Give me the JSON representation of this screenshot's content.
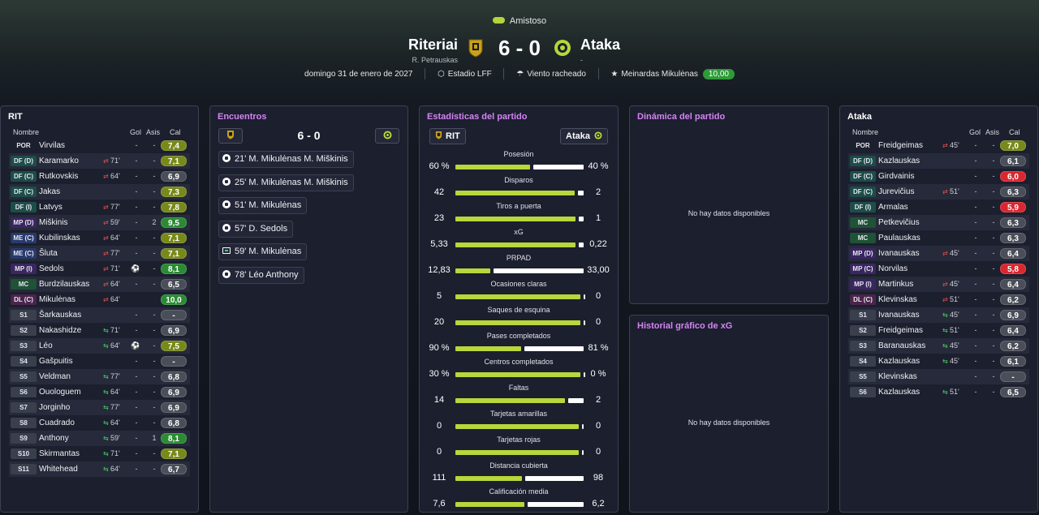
{
  "header": {
    "competition": "Amistoso",
    "home_name": "Riteriai",
    "home_manager": "R. Petrauskas",
    "away_name": "Ataka",
    "away_manager": "-",
    "score": "6 - 0",
    "date": "domingo 31 de enero de 2027",
    "stadium": "Estadio LFF",
    "weather": "Viento racheado",
    "motm_name": "Meinardas Mikulėnas",
    "motm_rating": "10,00"
  },
  "colors": {
    "accent": "#b9d63b",
    "pink_title": "#d683f4",
    "good": "#2b8a34",
    "bad": "#d92730"
  },
  "home_panel": {
    "title": "RIT",
    "col_name": "Nombre",
    "col_goals": "Gol",
    "col_assists": "Asis",
    "col_rating": "Cal",
    "players": [
      {
        "pos": "POR",
        "cls": "gk",
        "name": "Virvilas",
        "sub": "",
        "min": "",
        "goals": "-",
        "assists": "-",
        "rating": "7,4",
        "rc": "r-olive"
      },
      {
        "pos": "DF (D)",
        "cls": "df",
        "name": "Karamarko",
        "sub": "out",
        "min": "71'",
        "goals": "-",
        "assists": "-",
        "rating": "7,1",
        "rc": "r-olive"
      },
      {
        "pos": "DF (C)",
        "cls": "df",
        "name": "Rutkovskis",
        "sub": "out",
        "min": "64'",
        "goals": "-",
        "assists": "-",
        "rating": "6,9",
        "rc": "r-grey"
      },
      {
        "pos": "DF (C)",
        "cls": "df",
        "name": "Jakas",
        "sub": "",
        "min": "",
        "goals": "-",
        "assists": "-",
        "rating": "7,3",
        "rc": "r-olive"
      },
      {
        "pos": "DF (I)",
        "cls": "df",
        "name": "Latvys",
        "sub": "out",
        "min": "77'",
        "goals": "-",
        "assists": "-",
        "rating": "7,8",
        "rc": "r-olive"
      },
      {
        "pos": "MP (D)",
        "cls": "mf",
        "name": "Miškinis",
        "sub": "out",
        "min": "59'",
        "goals": "-",
        "assists": "2",
        "rating": "9,5",
        "rc": "r-green"
      },
      {
        "pos": "ME (C)",
        "cls": "me",
        "name": "Kubilinskas",
        "sub": "out",
        "min": "64'",
        "goals": "-",
        "assists": "-",
        "rating": "7,1",
        "rc": "r-olive"
      },
      {
        "pos": "ME (C)",
        "cls": "me",
        "name": "Šluta",
        "sub": "out",
        "min": "77'",
        "goals": "-",
        "assists": "-",
        "rating": "7,1",
        "rc": "r-olive"
      },
      {
        "pos": "MP (I)",
        "cls": "mf",
        "name": "Sedols",
        "sub": "out",
        "min": "71'",
        "goals": "ball",
        "assists": "-",
        "rating": "8,1",
        "rc": "r-green"
      },
      {
        "pos": "MC",
        "cls": "mc",
        "name": "Burdzilauskas",
        "sub": "out",
        "min": "64'",
        "goals": "-",
        "assists": "-",
        "rating": "6,5",
        "rc": "r-grey"
      },
      {
        "pos": "DL (C)",
        "cls": "dl",
        "name": "Mikulėnas",
        "sub": "out",
        "min": "64'",
        "goals": "",
        "assists": "",
        "rating": "10,0",
        "rc": "r-green"
      },
      {
        "pos": "S1",
        "cls": "sub",
        "name": "Šarkauskas",
        "sub": "",
        "min": "",
        "goals": "-",
        "assists": "-",
        "rating": "-",
        "rc": "r-grey"
      },
      {
        "pos": "S2",
        "cls": "sub",
        "name": "Nakashidze",
        "sub": "in",
        "min": "71'",
        "goals": "-",
        "assists": "-",
        "rating": "6,9",
        "rc": "r-grey"
      },
      {
        "pos": "S3",
        "cls": "sub",
        "name": "Léo",
        "sub": "in",
        "min": "64'",
        "goals": "ball",
        "assists": "-",
        "rating": "7,5",
        "rc": "r-olive"
      },
      {
        "pos": "S4",
        "cls": "sub",
        "name": "Gašpuitis",
        "sub": "",
        "min": "",
        "goals": "-",
        "assists": "-",
        "rating": "-",
        "rc": "r-grey"
      },
      {
        "pos": "S5",
        "cls": "sub",
        "name": "Veldman",
        "sub": "in",
        "min": "77'",
        "goals": "-",
        "assists": "-",
        "rating": "6,8",
        "rc": "r-grey"
      },
      {
        "pos": "S6",
        "cls": "sub",
        "name": "Ouologuem",
        "sub": "in",
        "min": "64'",
        "goals": "-",
        "assists": "-",
        "rating": "6,9",
        "rc": "r-grey"
      },
      {
        "pos": "S7",
        "cls": "sub",
        "name": "Jorginho",
        "sub": "in",
        "min": "77'",
        "goals": "-",
        "assists": "-",
        "rating": "6,9",
        "rc": "r-grey"
      },
      {
        "pos": "S8",
        "cls": "sub",
        "name": "Cuadrado",
        "sub": "in",
        "min": "64'",
        "goals": "-",
        "assists": "-",
        "rating": "6,8",
        "rc": "r-grey"
      },
      {
        "pos": "S9",
        "cls": "sub",
        "name": "Anthony",
        "sub": "in",
        "min": "59'",
        "goals": "-",
        "assists": "1",
        "rating": "8,1",
        "rc": "r-green"
      },
      {
        "pos": "S10",
        "cls": "sub",
        "name": "Skirmantas",
        "sub": "in",
        "min": "71'",
        "goals": "-",
        "assists": "-",
        "rating": "7,1",
        "rc": "r-olive"
      },
      {
        "pos": "S11",
        "cls": "sub",
        "name": "Whitehead",
        "sub": "in",
        "min": "64'",
        "goals": "-",
        "assists": "-",
        "rating": "6,7",
        "rc": "r-grey"
      }
    ]
  },
  "away_panel": {
    "title": "Ataka",
    "col_name": "Nombre",
    "col_goals": "Gol",
    "col_assists": "Asis",
    "col_rating": "Cal",
    "players": [
      {
        "pos": "POR",
        "cls": "gk",
        "name": "Freidgeimas",
        "sub": "out",
        "min": "45'",
        "goals": "-",
        "assists": "-",
        "rating": "7,0",
        "rc": "r-olive"
      },
      {
        "pos": "DF (D)",
        "cls": "df",
        "name": "Kazlauskas",
        "sub": "",
        "min": "",
        "goals": "-",
        "assists": "-",
        "rating": "6,1",
        "rc": "r-grey"
      },
      {
        "pos": "DF (C)",
        "cls": "df",
        "name": "Girdvainis",
        "sub": "",
        "min": "",
        "goals": "-",
        "assists": "-",
        "rating": "6,0",
        "rc": "r-red"
      },
      {
        "pos": "DF (C)",
        "cls": "df",
        "name": "Jurevičius",
        "sub": "out",
        "min": "51'",
        "goals": "-",
        "assists": "-",
        "rating": "6,3",
        "rc": "r-grey"
      },
      {
        "pos": "DF (I)",
        "cls": "df",
        "name": "Armalas",
        "sub": "",
        "min": "",
        "goals": "-",
        "assists": "-",
        "rating": "5,9",
        "rc": "r-red"
      },
      {
        "pos": "MC",
        "cls": "mc",
        "name": "Petkevičius",
        "sub": "",
        "min": "",
        "goals": "-",
        "assists": "-",
        "rating": "6,3",
        "rc": "r-grey"
      },
      {
        "pos": "MC",
        "cls": "mc",
        "name": "Paulauskas",
        "sub": "",
        "min": "",
        "goals": "-",
        "assists": "-",
        "rating": "6,3",
        "rc": "r-grey"
      },
      {
        "pos": "MP (D)",
        "cls": "mf",
        "name": "Ivanauskas",
        "sub": "out",
        "min": "45'",
        "goals": "-",
        "assists": "-",
        "rating": "6,4",
        "rc": "r-grey"
      },
      {
        "pos": "MP (C)",
        "cls": "mf",
        "name": "Norvilas",
        "sub": "",
        "min": "",
        "goals": "-",
        "assists": "-",
        "rating": "5,8",
        "rc": "r-red"
      },
      {
        "pos": "MP (I)",
        "cls": "mf",
        "name": "Martinkus",
        "sub": "out",
        "min": "45'",
        "goals": "-",
        "assists": "-",
        "rating": "6,4",
        "rc": "r-grey"
      },
      {
        "pos": "DL (C)",
        "cls": "dl",
        "name": "Klevinskas",
        "sub": "out",
        "min": "51'",
        "goals": "-",
        "assists": "-",
        "rating": "6,2",
        "rc": "r-grey"
      },
      {
        "pos": "S1",
        "cls": "sub",
        "name": "Ivanauskas",
        "sub": "in",
        "min": "45'",
        "goals": "-",
        "assists": "-",
        "rating": "6,9",
        "rc": "r-grey"
      },
      {
        "pos": "S2",
        "cls": "sub",
        "name": "Freidgeimas",
        "sub": "in",
        "min": "51'",
        "goals": "-",
        "assists": "-",
        "rating": "6,4",
        "rc": "r-grey"
      },
      {
        "pos": "S3",
        "cls": "sub",
        "name": "Baranauskas",
        "sub": "in",
        "min": "45'",
        "goals": "-",
        "assists": "-",
        "rating": "6,2",
        "rc": "r-grey"
      },
      {
        "pos": "S4",
        "cls": "sub",
        "name": "Kazlauskas",
        "sub": "in",
        "min": "45'",
        "goals": "-",
        "assists": "-",
        "rating": "6,1",
        "rc": "r-grey"
      },
      {
        "pos": "S5",
        "cls": "sub",
        "name": "Klevinskas",
        "sub": "",
        "min": "",
        "goals": "-",
        "assists": "-",
        "rating": "-",
        "rc": "r-grey"
      },
      {
        "pos": "S6",
        "cls": "sub",
        "name": "Kazlauskas",
        "sub": "in",
        "min": "51'",
        "goals": "-",
        "assists": "-",
        "rating": "6,5",
        "rc": "r-grey"
      }
    ]
  },
  "encounters": {
    "title": "Encuentros",
    "score": "6 - 0",
    "events": [
      {
        "type": "goal",
        "text": "21' M. Mikulėnas M. Miškinis"
      },
      {
        "type": "goal",
        "text": "25' M. Mikulėnas M. Miškinis"
      },
      {
        "type": "goal",
        "text": "51' M. Mikulėnas"
      },
      {
        "type": "goal",
        "text": "57' D. Sedols"
      },
      {
        "type": "var",
        "text": "59' M. Mikulėnas"
      },
      {
        "type": "goal",
        "text": "78' Léo Anthony"
      }
    ]
  },
  "stats": {
    "title": "Estadísticas del partido",
    "home_label": "RIT",
    "away_label": "Ataka",
    "rows": [
      {
        "label": "Posesión",
        "home": "60 %",
        "away": "40 %",
        "hs": 60,
        "as": 40
      },
      {
        "label": "Disparos",
        "home": "42",
        "away": "2",
        "hs": 42,
        "as": 2
      },
      {
        "label": "Tiros a puerta",
        "home": "23",
        "away": "1",
        "hs": 23,
        "as": 1
      },
      {
        "label": "xG",
        "home": "5,33",
        "away": "0,22",
        "hs": 5.33,
        "as": 0.22
      },
      {
        "label": "PRPAD",
        "home": "12,83",
        "away": "33,00",
        "hs": 12.83,
        "as": 33.0
      },
      {
        "label": "Ocasiones claras",
        "home": "5",
        "away": "0",
        "hs": 5,
        "as": 0
      },
      {
        "label": "Saques de esquina",
        "home": "20",
        "away": "0",
        "hs": 20,
        "as": 0
      },
      {
        "label": "Pases completados",
        "home": "90 %",
        "away": "81 %",
        "hs": 90,
        "as": 81
      },
      {
        "label": "Centros completados",
        "home": "30 %",
        "away": "0 %",
        "hs": 30,
        "as": 0
      },
      {
        "label": "Faltas",
        "home": "14",
        "away": "2",
        "hs": 14,
        "as": 2
      },
      {
        "label": "Tarjetas amarillas",
        "home": "0",
        "away": "0",
        "hs": 0,
        "as": 0
      },
      {
        "label": "Tarjetas rojas",
        "home": "0",
        "away": "0",
        "hs": 0,
        "as": 0
      },
      {
        "label": "Distancia cubierta",
        "home": "111",
        "away": "98",
        "hs": 111,
        "as": 98
      },
      {
        "label": "Calificación media",
        "home": "7,6",
        "away": "6,2",
        "hs": 7.6,
        "as": 6.2
      }
    ]
  },
  "dynamics": {
    "title": "Dinámica del partido",
    "empty": "No hay datos disponibles"
  },
  "xg_history": {
    "title": "Historial gráfico de xG",
    "empty": "No hay datos disponibles"
  }
}
